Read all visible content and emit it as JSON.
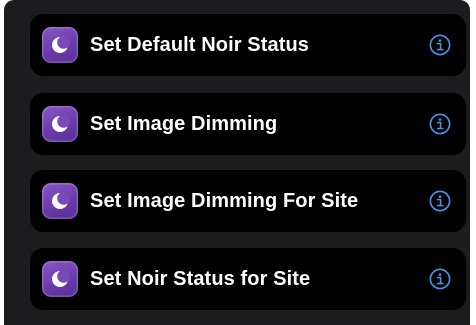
{
  "actions": [
    {
      "label": "Set Default Noir Status",
      "icon": "noir-moon-icon",
      "info_icon": "info-icon"
    },
    {
      "label": "Set Image Dimming",
      "icon": "noir-moon-icon",
      "info_icon": "info-icon"
    },
    {
      "label": "Set Image Dimming For Site",
      "icon": "noir-moon-icon",
      "info_icon": "info-icon"
    },
    {
      "label": "Set Noir Status for Site",
      "icon": "noir-moon-icon",
      "info_icon": "info-icon"
    }
  ],
  "colors": {
    "background": "#1c1c1e",
    "row_background": "#000000",
    "text": "#ffffff",
    "icon_purple": "#7a48b8",
    "info_blue": "#4a90e2"
  }
}
